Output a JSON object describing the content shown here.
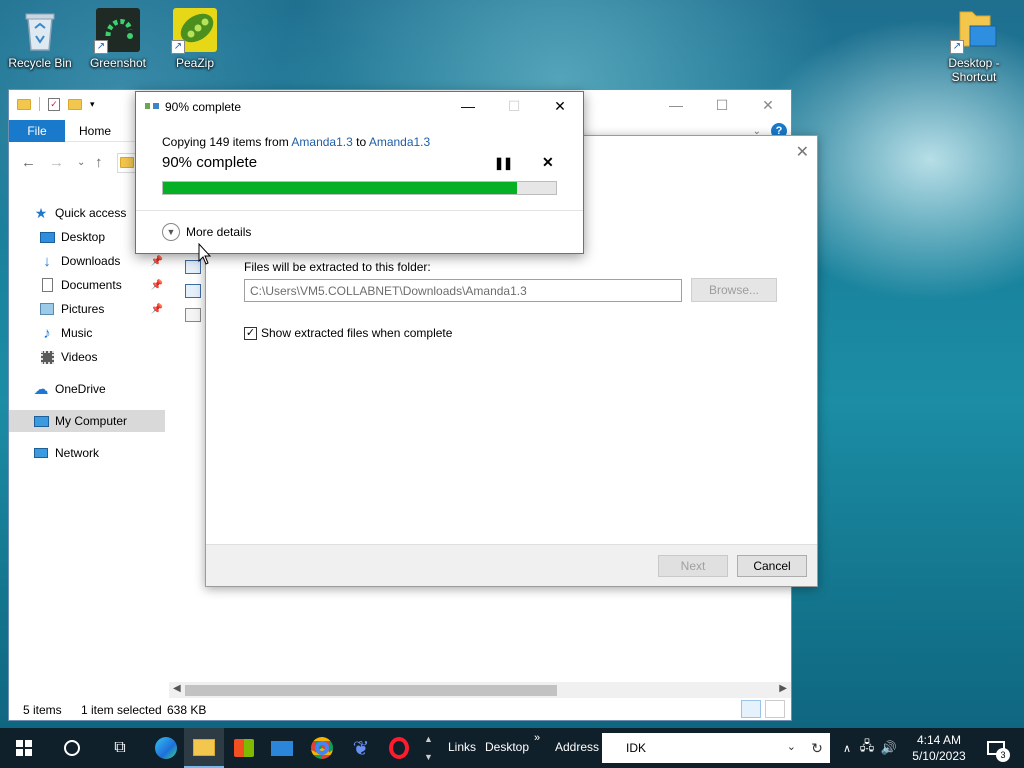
{
  "desktop": {
    "icons": [
      {
        "label": "Recycle Bin"
      },
      {
        "label": "Greenshot"
      },
      {
        "label": "PeaZip"
      },
      {
        "label_line1": "Desktop -",
        "label_line2": "Shortcut"
      }
    ]
  },
  "explorer": {
    "tabs": {
      "file": "File",
      "home": "Home"
    },
    "nav": {
      "quick_access": "Quick access",
      "desktop": "Desktop",
      "downloads": "Downloads",
      "documents": "Documents",
      "pictures": "Pictures",
      "music": "Music",
      "videos": "Videos",
      "onedrive": "OneDrive",
      "my_computer": "My Computer",
      "network": "Network"
    },
    "status": {
      "items": "5 items",
      "selected": "1 item selected",
      "size": "638 KB"
    }
  },
  "wizard": {
    "extract_label": "Files will be extracted to this folder:",
    "path_value": "C:\\Users\\VM5.COLLABNET\\Downloads\\Amanda1.3",
    "browse": "Browse...",
    "show_files": "Show extracted files when complete",
    "show_files_checked": true,
    "next": "Next",
    "cancel": "Cancel"
  },
  "progress": {
    "title": "90% complete",
    "copy_prefix": "Copying 149 items from ",
    "source": "Amanda1.3",
    "to_word": " to ",
    "dest": "Amanda1.3",
    "percent_text": "90% complete",
    "fraction": 0.9,
    "more_details": "More details",
    "color": "#06b025"
  },
  "taskbar": {
    "links": "Links",
    "desktop": "Desktop",
    "address_label": "Address",
    "address_value": "IDK",
    "time": "4:14 AM",
    "date": "5/10/2023",
    "notifications": "3"
  }
}
